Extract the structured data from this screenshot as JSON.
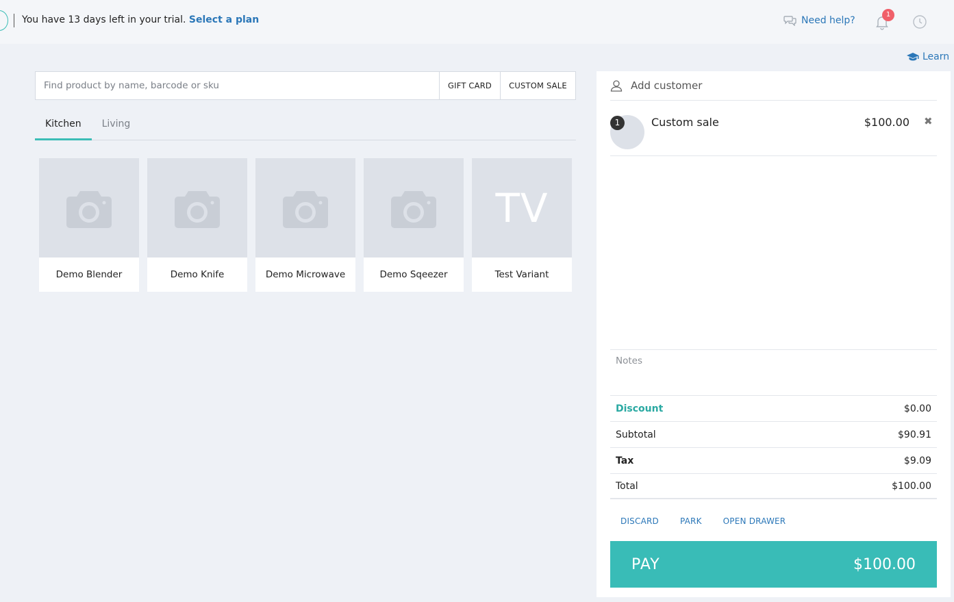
{
  "topbar": {
    "trial_text": "You have 13 days left in your trial.",
    "trial_link": "Select a plan",
    "help_label": "Need help?",
    "notification_count": "1"
  },
  "learn_label": "Learn",
  "search": {
    "placeholder": "Find product by name, barcode or sku",
    "gift_card_label": "GIFT CARD",
    "custom_sale_label": "CUSTOM SALE"
  },
  "tabs": [
    {
      "label": "Kitchen",
      "active": true
    },
    {
      "label": "Living",
      "active": false
    }
  ],
  "products": [
    {
      "name": "Demo Blender",
      "thumb": "camera-icon"
    },
    {
      "name": "Demo Knife",
      "thumb": "camera-icon"
    },
    {
      "name": "Demo Microwave",
      "thumb": "camera-icon"
    },
    {
      "name": "Demo Sqeezer",
      "thumb": "camera-icon"
    },
    {
      "name": "Test Variant",
      "thumb_text": "TV"
    }
  ],
  "cart": {
    "add_customer_label": "Add customer",
    "line_items": [
      {
        "quantity": "1",
        "name": "Custom sale",
        "price": "$100.00"
      }
    ],
    "notes_placeholder": "Notes",
    "discount_label": "Discount",
    "discount_value": "$0.00",
    "subtotal_label": "Subtotal",
    "subtotal_value": "$90.91",
    "tax_label": "Tax",
    "tax_value": "$9.09",
    "total_label": "Total",
    "total_value": "$100.00",
    "discard_label": "DISCARD",
    "park_label": "PARK",
    "open_drawer_label": "OPEN DRAWER",
    "pay_label": "PAY",
    "pay_amount": "$100.00"
  },
  "colors": {
    "accent": "#39bcb7",
    "link": "#2b77b8",
    "badge": "#f0606a"
  }
}
